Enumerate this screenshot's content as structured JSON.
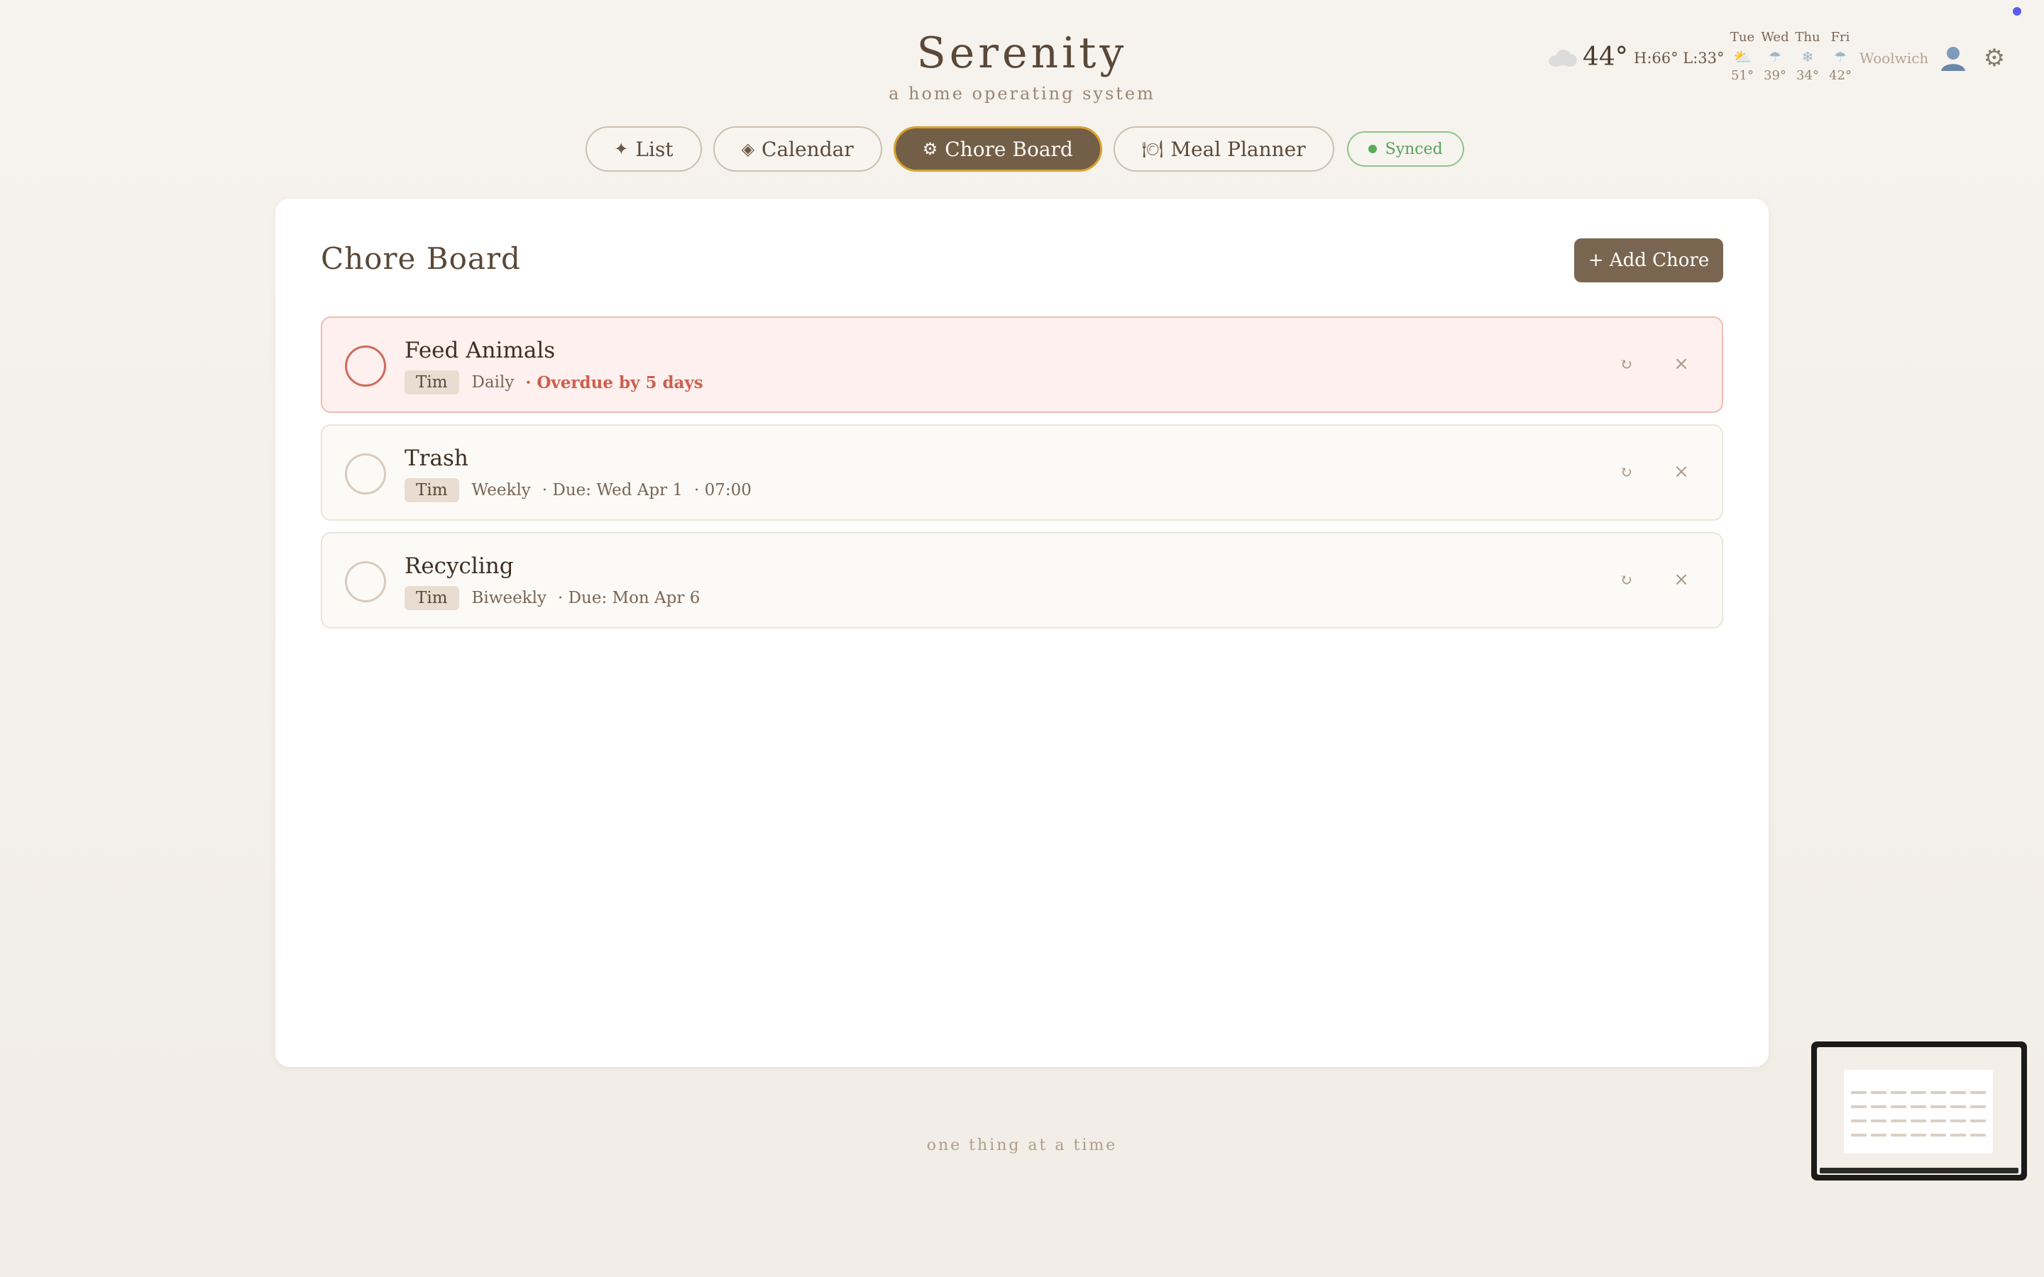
{
  "app": {
    "title": "Serenity",
    "subtitle": "a home operating system",
    "footer": "one thing at a time"
  },
  "weather": {
    "current_icon": "cloud-icon",
    "current_temp": "44°",
    "hilo": "H:66° L:33°",
    "forecast": [
      {
        "day": "Tue",
        "icon": "sun-cloud-icon",
        "temp": "51°"
      },
      {
        "day": "Wed",
        "icon": "rain-icon",
        "temp": "39°"
      },
      {
        "day": "Thu",
        "icon": "snow-icon",
        "temp": "34°"
      },
      {
        "day": "Fri",
        "icon": "rain-icon",
        "temp": "42°"
      }
    ],
    "location": "Woolwich"
  },
  "nav": {
    "tabs": [
      {
        "label": "List",
        "icon": "sparkle-icon",
        "glyph": "✦",
        "active": false
      },
      {
        "label": "Calendar",
        "icon": "diamond-icon",
        "glyph": "◈",
        "active": false
      },
      {
        "label": "Chore Board",
        "icon": "gear-small-icon",
        "glyph": "⚙",
        "active": true
      },
      {
        "label": "Meal Planner",
        "icon": "plate-icon",
        "glyph": "🍽",
        "active": false
      }
    ],
    "sync_status": "Synced"
  },
  "board": {
    "title": "Chore Board",
    "add_label": "+ Add Chore",
    "chores": [
      {
        "name": "Feed Animals",
        "assignee": "Tim",
        "frequency": "Daily",
        "status": "· Overdue by 5 days",
        "time": "",
        "overdue": true
      },
      {
        "name": "Trash",
        "assignee": "Tim",
        "frequency": "Weekly",
        "status": "· Due: Wed Apr 1",
        "time": "· 07:00",
        "overdue": false
      },
      {
        "name": "Recycling",
        "assignee": "Tim",
        "frequency": "Biweekly",
        "status": "· Due: Mon Apr 6",
        "time": "",
        "overdue": false
      }
    ],
    "repeat_glyph": "↻",
    "delete_glyph": "×"
  },
  "colors": {
    "accent": "#735e48",
    "active_border": "#d8a12e",
    "overdue": "#cd5f4d",
    "synced": "#5cac59"
  }
}
